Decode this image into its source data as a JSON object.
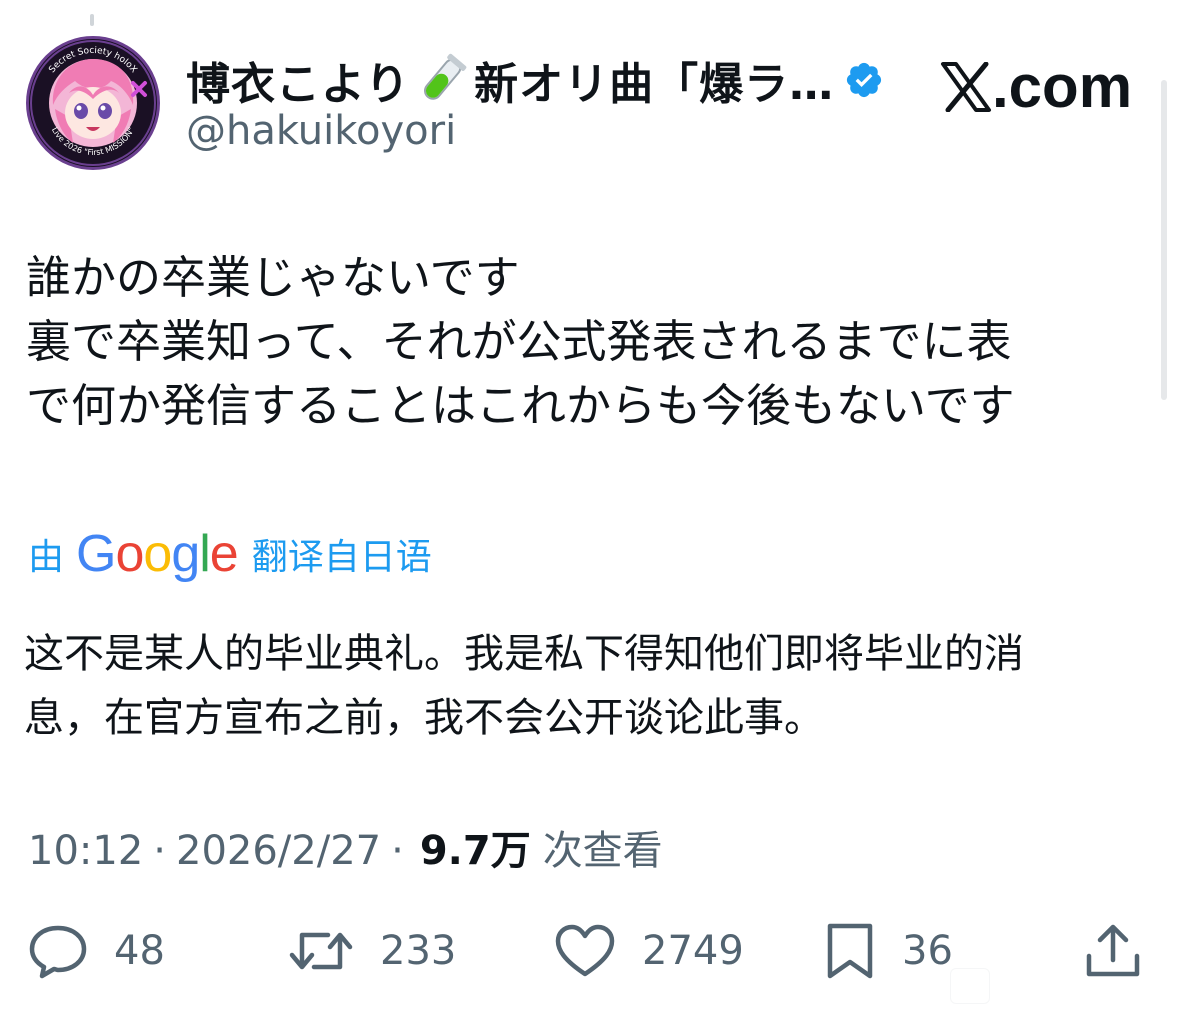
{
  "header": {
    "display_name": "博衣こより",
    "display_name_suffix": "新オリ曲「爆ラ…",
    "handle": "@hakuikoyori",
    "avatar_ring_text_top": "Secret Society holoX",
    "avatar_ring_text_bottom": "Live 2026 \"First MISSION\"",
    "brand_text": ".com"
  },
  "tweet": {
    "lines": [
      "誰かの卒業じゃないです",
      "裏で卒業知って、それが公式発表されるまでに表",
      "で何か発信することはこれからも今後もないです"
    ]
  },
  "translation": {
    "prefix": "由",
    "provider": "Google",
    "suffix": "翻译自日语",
    "lines": [
      "这不是某人的毕业典礼。我是私下得知他们即将毕业的消",
      "息，在官方宣布之前，我不会公开谈论此事。"
    ]
  },
  "meta": {
    "time": "10:12",
    "date": "2026/2/27",
    "views": "9.7万",
    "views_label": "次查看"
  },
  "actions": {
    "replies": "48",
    "reposts": "233",
    "likes": "2749",
    "bookmarks": "36"
  },
  "colors": {
    "text": "#0f1419",
    "secondary": "#536471",
    "accent": "#1d9bf0",
    "verified": "#1d9bf0",
    "tube_liquid": "#52c41a"
  },
  "icons": {
    "reply": "speech-bubble-icon",
    "repost": "repost-arrows-icon",
    "like": "heart-icon",
    "bookmark": "bookmark-icon",
    "share": "share-upload-icon"
  }
}
